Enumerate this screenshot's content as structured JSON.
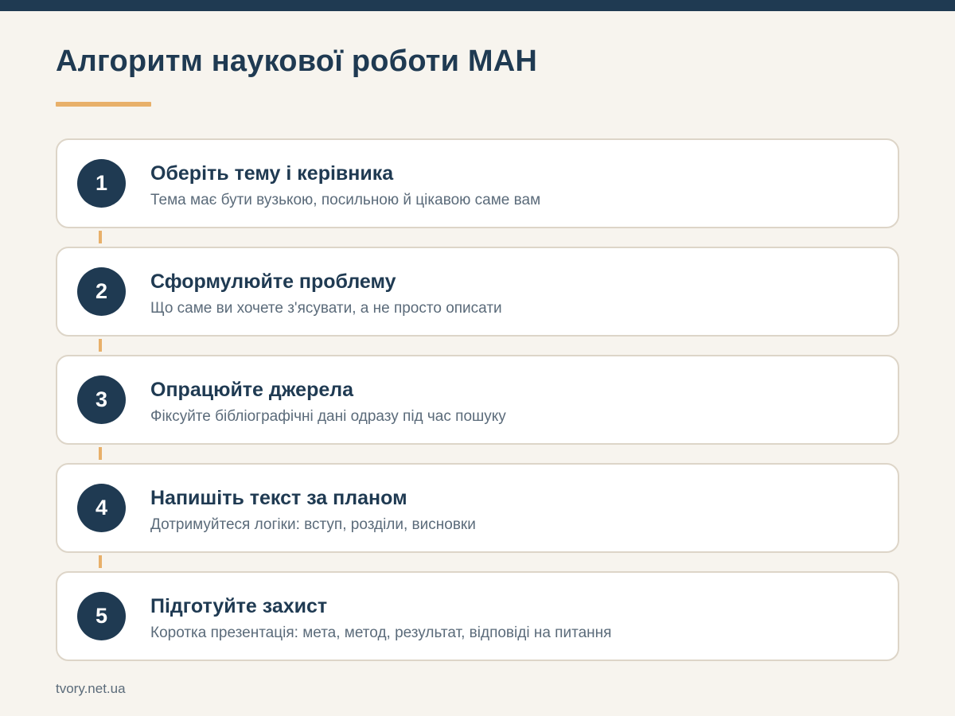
{
  "title": "Алгоритм наукової роботи МАН",
  "steps": [
    {
      "number": "1",
      "title": "Оберіть тему і керівника",
      "description": "Тема має бути вузькою, посильною й цікавою саме вам"
    },
    {
      "number": "2",
      "title": "Сформулюйте проблему",
      "description": "Що саме ви хочете з'ясувати, а не просто описати"
    },
    {
      "number": "3",
      "title": "Опрацюйте джерела",
      "description": "Фіксуйте бібліографічні дані одразу під час пошуку"
    },
    {
      "number": "4",
      "title": "Напишіть текст за планом",
      "description": "Дотримуйтеся логіки: вступ, розділи, висновки"
    },
    {
      "number": "5",
      "title": "Підготуйте захист",
      "description": "Коротка презентація: мета, метод, результат, відповіді на питання"
    }
  ],
  "footer": {
    "source": "tvory.net.ua"
  },
  "colors": {
    "primary": "#1f3a52",
    "accent": "#e8b06a",
    "background": "#f7f4ee",
    "card_border": "#ddd5c8",
    "muted_text": "#5b6b7a"
  }
}
